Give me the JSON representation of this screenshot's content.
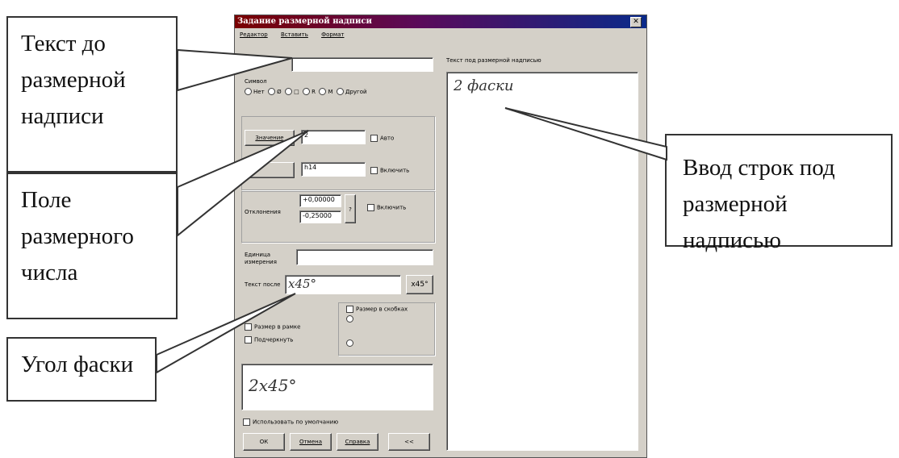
{
  "dialog": {
    "title": "Задание размерной надписи",
    "close_glyph": "✕",
    "menu": [
      "Редактор",
      "Вставить",
      "Формат"
    ],
    "right_panel_label": "Текст под размерной надписью",
    "lines_below_text": "2 фаски",
    "symbol_group_label": "Символ",
    "symbols": [
      "Нет",
      "Ø",
      "□",
      "R",
      "M",
      "Другой"
    ],
    "value_button": "Значение",
    "value_field": "2",
    "auto_label": "Авто",
    "quality_field": "h14",
    "include_label": "Включить",
    "deviations_label": "Отклонения",
    "upper_deviation": "+0,00000",
    "lower_deviation": "-0,25000",
    "deviations_button": "?",
    "deviations_include_label": "Включить",
    "units_label": "Единица измерения",
    "text_after_label": "Текст после",
    "text_after_value": "x45°",
    "text_after_button": "x45°",
    "size_in_frame_label": "Размер в рамке",
    "underline_label": "Подчеркнуть",
    "size_in_brackets_label": "Размер в скобках",
    "preview_text": "2x45°",
    "use_default_label": "Использовать по умолчанию",
    "buttons": [
      "ОК",
      "Отмена",
      "Справка",
      "<<"
    ]
  },
  "callouts": {
    "text_before": [
      "Текст до",
      "размерной",
      "надписи"
    ],
    "dim_number": [
      "Поле",
      "размерного",
      "числа"
    ],
    "chamfer_angle": [
      "Угол фаски"
    ],
    "lines_below": [
      "Ввод строк под",
      "размерной надписью"
    ]
  }
}
